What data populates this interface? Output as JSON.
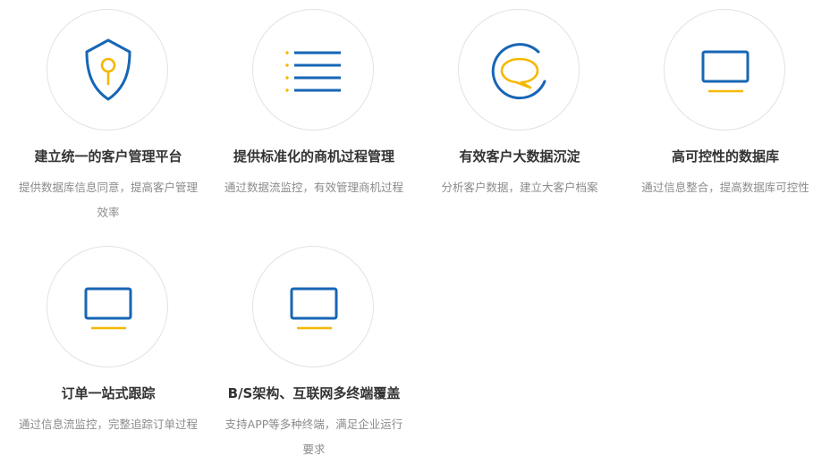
{
  "colors": {
    "blue": "#1766b5",
    "gold": "#f5b800",
    "ring": "#e2e2e2"
  },
  "cards": [
    {
      "icon": "shield-key-icon",
      "title": "建立统一的客户管理平台",
      "desc": "提供数据库信息同意，提高客户管理效率"
    },
    {
      "icon": "list-icon",
      "title": "提供标准化的商机过程管理",
      "desc": "通过数据流监控，有效管理商机过程"
    },
    {
      "icon": "chat-bubble-icon",
      "title": "有效客户大数据沉淀",
      "desc": "分析客户数据，建立大客户档案"
    },
    {
      "icon": "monitor-icon",
      "title": "高可控性的数据库",
      "desc": "通过信息整合，提高数据库可控性"
    },
    {
      "icon": "monitor-icon",
      "title": "订单一站式跟踪",
      "desc": "通过信息流监控，完整追踪订单过程"
    },
    {
      "icon": "monitor-icon",
      "title": "B/S架构、互联网多终端覆盖",
      "desc": "支持APP等多种终端，满足企业运行要求"
    }
  ]
}
